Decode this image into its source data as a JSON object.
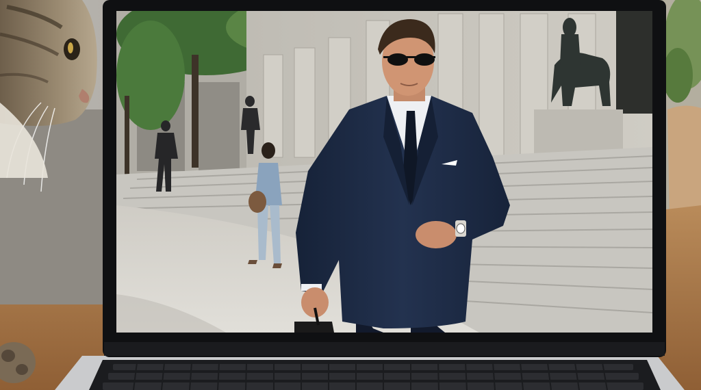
{
  "scene": {
    "subject": "man-in-navy-suit",
    "background_subject": "courthouse-steps",
    "colors": {
      "wall": "#a9a7a2",
      "desk": "#a8794a",
      "laptop_body": "#c9c9cb",
      "bezel": "#111214",
      "keyboard": "#1b1c1f",
      "suit": "#1d2b45",
      "steps": "#c9c7c1",
      "pavement": "#d8d6d0",
      "tree": "#3f6a34",
      "statue": "#2e3532",
      "cat_fur": "#8b7a62"
    }
  }
}
